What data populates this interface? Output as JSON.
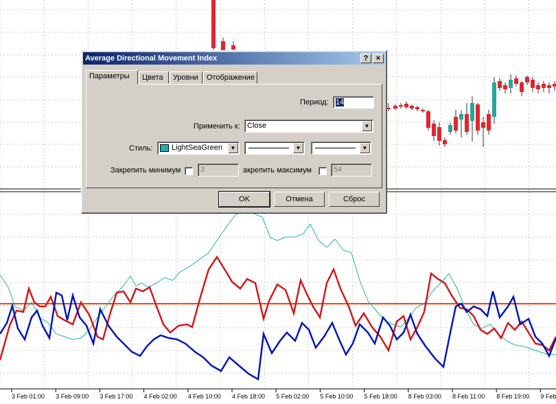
{
  "dialog": {
    "title": "Average Directional Movement Index",
    "help_label": "?",
    "close_label": "×",
    "tabs": [
      {
        "label": "Параметры",
        "active": true
      },
      {
        "label": "Цвета",
        "active": false
      },
      {
        "label": "Уровни",
        "active": false
      },
      {
        "label": "Отображение",
        "active": false
      }
    ],
    "period": {
      "label": "Период:",
      "value": "14"
    },
    "apply_to": {
      "label": "Применить к:",
      "value": "Close"
    },
    "style": {
      "label": "Стиль:",
      "color_name": "LightSeaGreen",
      "color_hex": "#20b2aa"
    },
    "fix_min": {
      "label": "Закрепить минимум",
      "value": "3"
    },
    "fix_max": {
      "label": "акрепить максимум",
      "value": "54"
    },
    "buttons": {
      "ok": "OK",
      "cancel": "Отмена",
      "reset": "Сброс"
    },
    "dropdown_arrow_icon": "triangle-down"
  },
  "chart": {
    "time_labels": [
      "3 Feb 01:00",
      "3 Feb 09:00",
      "3 Feb 17:00",
      "4 Feb 02:00",
      "4 Feb 10:00",
      "4 Feb 18:00",
      "5 Feb 02:00",
      "5 Feb 10:00",
      "5 Feb 18:00",
      "8 Feb 03:00",
      "8 Feb 11:00",
      "8 Feb 19:00",
      "9 Feb"
    ],
    "level_color": "#ff4500",
    "plus_di_color": "#d11a1a",
    "minus_di_color": "#0018b4",
    "adx_color": "#20b2aa",
    "bull_color": "#26a69a",
    "bear_color": "#e0262e"
  }
}
